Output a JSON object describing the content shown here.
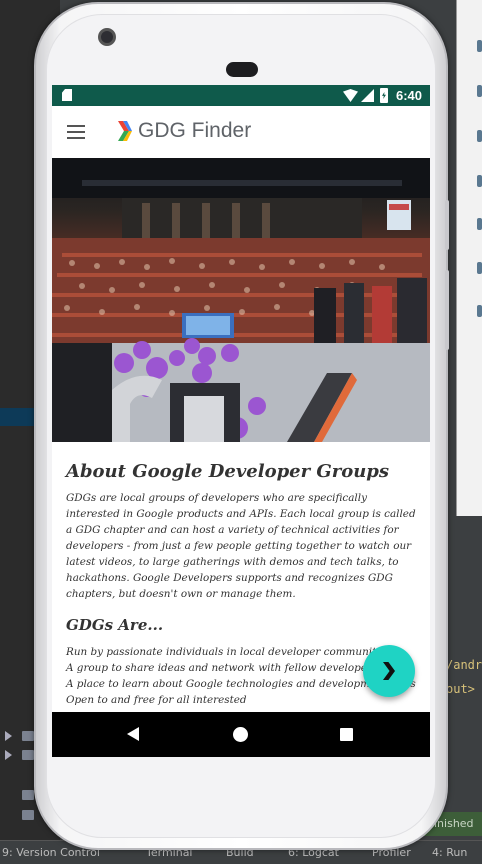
{
  "ide": {
    "code_line_1": "/andr",
    "code_line_2": "out>",
    "finished_label": "inished",
    "status_items": [
      "9: Version Control",
      "Terminal",
      "Build",
      "6: Logcat",
      "Profiler",
      "4: Run"
    ]
  },
  "status_bar": {
    "time": "6:40",
    "icons": [
      "sd-card-icon",
      "wifi-icon",
      "signal-icon",
      "battery-charging-icon"
    ],
    "color": "#0f5a4b"
  },
  "app_bar": {
    "title": "GDG Finder",
    "menu_icon": "hamburger-menu-icon",
    "logo_icon": "gdg-chevron-logo-icon"
  },
  "hero_image": {
    "description_icon": "conference-audience-photo"
  },
  "about": {
    "title": "About Google Developer Groups",
    "body": "GDGs are local groups of developers who are specifically interested in Google products and APIs. Each local group is called a GDG chapter and can host a variety of technical activities for developers - from just a few people getting together to watch our latest videos, to large gatherings with demos and tech talks, to hackathons. Google Developers supports and recognizes GDG chapters, but doesn't own or manage them."
  },
  "gdgs_are": {
    "title": "GDGs Are...",
    "items": [
      "Run by passionate individuals in local developer communities",
      "A group to share ideas and network with fellow developers",
      "A place to learn about Google technologies and development tools",
      "Open to and free for all interested"
    ]
  },
  "fab": {
    "icon": "chevron-right-icon",
    "color": "#1fd3c4"
  },
  "nav_bar": {
    "icons": [
      "back-icon",
      "home-icon",
      "recent-apps-icon"
    ]
  }
}
